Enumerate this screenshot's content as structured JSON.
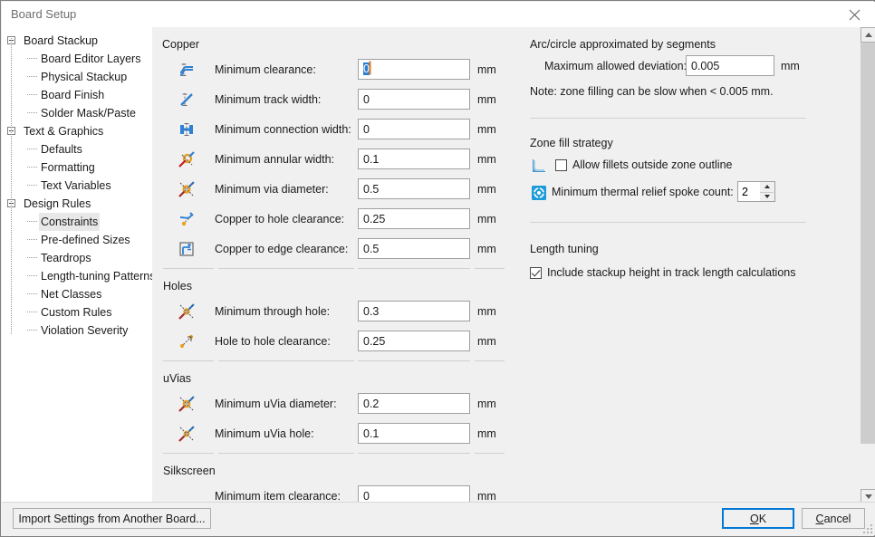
{
  "window": {
    "title": "Board Setup",
    "close_icon": "close-icon"
  },
  "sidebar": {
    "items": [
      {
        "label": "Board Stackup",
        "level": 0,
        "expandable": true,
        "selected": false
      },
      {
        "label": "Board Editor Layers",
        "level": 1,
        "expandable": false,
        "selected": false
      },
      {
        "label": "Physical Stackup",
        "level": 1,
        "expandable": false,
        "selected": false
      },
      {
        "label": "Board Finish",
        "level": 1,
        "expandable": false,
        "selected": false
      },
      {
        "label": "Solder Mask/Paste",
        "level": 1,
        "expandable": false,
        "selected": false
      },
      {
        "label": "Text & Graphics",
        "level": 0,
        "expandable": true,
        "selected": false
      },
      {
        "label": "Defaults",
        "level": 1,
        "expandable": false,
        "selected": false
      },
      {
        "label": "Formatting",
        "level": 1,
        "expandable": false,
        "selected": false
      },
      {
        "label": "Text Variables",
        "level": 1,
        "expandable": false,
        "selected": false
      },
      {
        "label": "Design Rules",
        "level": 0,
        "expandable": true,
        "selected": false
      },
      {
        "label": "Constraints",
        "level": 1,
        "expandable": false,
        "selected": true
      },
      {
        "label": "Pre-defined Sizes",
        "level": 1,
        "expandable": false,
        "selected": false
      },
      {
        "label": "Teardrops",
        "level": 1,
        "expandable": false,
        "selected": false
      },
      {
        "label": "Length-tuning Patterns",
        "level": 1,
        "expandable": false,
        "selected": false
      },
      {
        "label": "Net Classes",
        "level": 1,
        "expandable": false,
        "selected": false
      },
      {
        "label": "Custom Rules",
        "level": 1,
        "expandable": false,
        "selected": false
      },
      {
        "label": "Violation Severity",
        "level": 1,
        "expandable": false,
        "selected": false
      }
    ]
  },
  "constraints": {
    "copper": {
      "title": "Copper",
      "rows": [
        {
          "icon": "min-clearance-icon",
          "label": "Minimum clearance:",
          "value": "0",
          "unit": "mm",
          "focused": true
        },
        {
          "icon": "min-track-width-icon",
          "label": "Minimum track width:",
          "value": "0",
          "unit": "mm",
          "focused": false
        },
        {
          "icon": "min-connection-width-icon",
          "label": "Minimum connection width:",
          "value": "0",
          "unit": "mm",
          "focused": false
        },
        {
          "icon": "min-annular-width-icon",
          "label": "Minimum annular width:",
          "value": "0.1",
          "unit": "mm",
          "focused": false
        },
        {
          "icon": "min-via-diameter-icon",
          "label": "Minimum via diameter:",
          "value": "0.5",
          "unit": "mm",
          "focused": false
        },
        {
          "icon": "copper-to-hole-icon",
          "label": "Copper to hole clearance:",
          "value": "0.25",
          "unit": "mm",
          "focused": false
        },
        {
          "icon": "copper-to-edge-icon",
          "label": "Copper to edge clearance:",
          "value": "0.5",
          "unit": "mm",
          "focused": false
        }
      ]
    },
    "holes": {
      "title": "Holes",
      "rows": [
        {
          "icon": "min-through-hole-icon",
          "label": "Minimum through hole:",
          "value": "0.3",
          "unit": "mm",
          "focused": false
        },
        {
          "icon": "hole-to-hole-icon",
          "label": "Hole to hole clearance:",
          "value": "0.25",
          "unit": "mm",
          "focused": false
        }
      ]
    },
    "uvias": {
      "title": "uVias",
      "rows": [
        {
          "icon": "min-uvia-diameter-icon",
          "label": "Minimum uVia diameter:",
          "value": "0.2",
          "unit": "mm",
          "focused": false
        },
        {
          "icon": "min-uvia-hole-icon",
          "label": "Minimum uVia hole:",
          "value": "0.1",
          "unit": "mm",
          "focused": false
        }
      ]
    },
    "silkscreen": {
      "title": "Silkscreen",
      "rows": [
        {
          "icon": "",
          "label": "Minimum item clearance:",
          "value": "0",
          "unit": "mm",
          "focused": false
        }
      ]
    }
  },
  "right_panel": {
    "arc": {
      "title": "Arc/circle approximated by segments",
      "deviation_label": "Maximum allowed deviation:",
      "deviation_value": "0.005",
      "deviation_unit": "mm",
      "note": "Note: zone filling can be slow when < 0.005 mm."
    },
    "zone_fill": {
      "title": "Zone fill strategy",
      "fillets_icon": "fillet-corner-icon",
      "fillets_label": "Allow fillets outside zone outline",
      "fillets_checked": false,
      "spoke_icon": "thermal-relief-icon",
      "spoke_label": "Minimum thermal relief spoke count:",
      "spoke_value": "2"
    },
    "length_tuning": {
      "title": "Length tuning",
      "stackup_label": "Include stackup height in track length calculations",
      "stackup_checked": true
    }
  },
  "buttons": {
    "import": "Import Settings from Another Board...",
    "ok": "OK",
    "ok_mnemonic": "O",
    "cancel": "Cancel",
    "cancel_mnemonic": "C"
  },
  "scrollbar": {
    "up_icon": "scroll-up-icon",
    "down_icon": "scroll-down-icon"
  }
}
